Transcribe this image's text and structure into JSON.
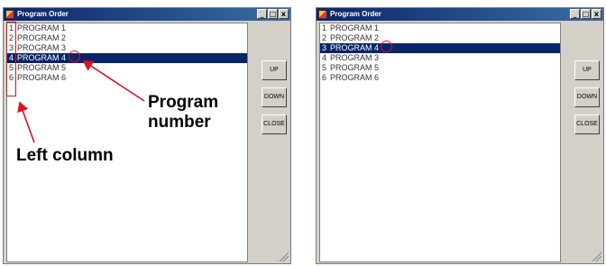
{
  "colors": {
    "annotation_red": "#e01020",
    "selection_blue": "#0a246a",
    "titlebar_blue": "#0a246a"
  },
  "left_window": {
    "title": "Program Order",
    "controls": [
      "_",
      "□",
      "x"
    ],
    "items": [
      {
        "num": "1",
        "name": "PROGRAM 1"
      },
      {
        "num": "2",
        "name": "PROGRAM 2"
      },
      {
        "num": "3",
        "name": "PROGRAM 3"
      },
      {
        "num": "4",
        "name": "PROGRAM 4",
        "selected": true
      },
      {
        "num": "5",
        "name": "PROGRAM 5"
      },
      {
        "num": "6",
        "name": "PROGRAM 6"
      }
    ],
    "buttons": {
      "up": "UP",
      "down": "DOWN",
      "close": "CLOSE"
    }
  },
  "right_window": {
    "title": "Program Order",
    "controls": [
      "_",
      "□",
      "x"
    ],
    "items": [
      {
        "num": "1",
        "name": "PROGRAM 1"
      },
      {
        "num": "2",
        "name": "PROGRAM 2"
      },
      {
        "num": "3",
        "name": "PROGRAM 4",
        "selected": true
      },
      {
        "num": "4",
        "name": "PROGRAM 3"
      },
      {
        "num": "5",
        "name": "PROGRAM 5"
      },
      {
        "num": "6",
        "name": "PROGRAM 6"
      }
    ],
    "buttons": {
      "up": "UP",
      "down": "DOWN",
      "close": "CLOSE"
    }
  },
  "annotations": {
    "program_number": "Program number",
    "left_column": "Left column"
  }
}
